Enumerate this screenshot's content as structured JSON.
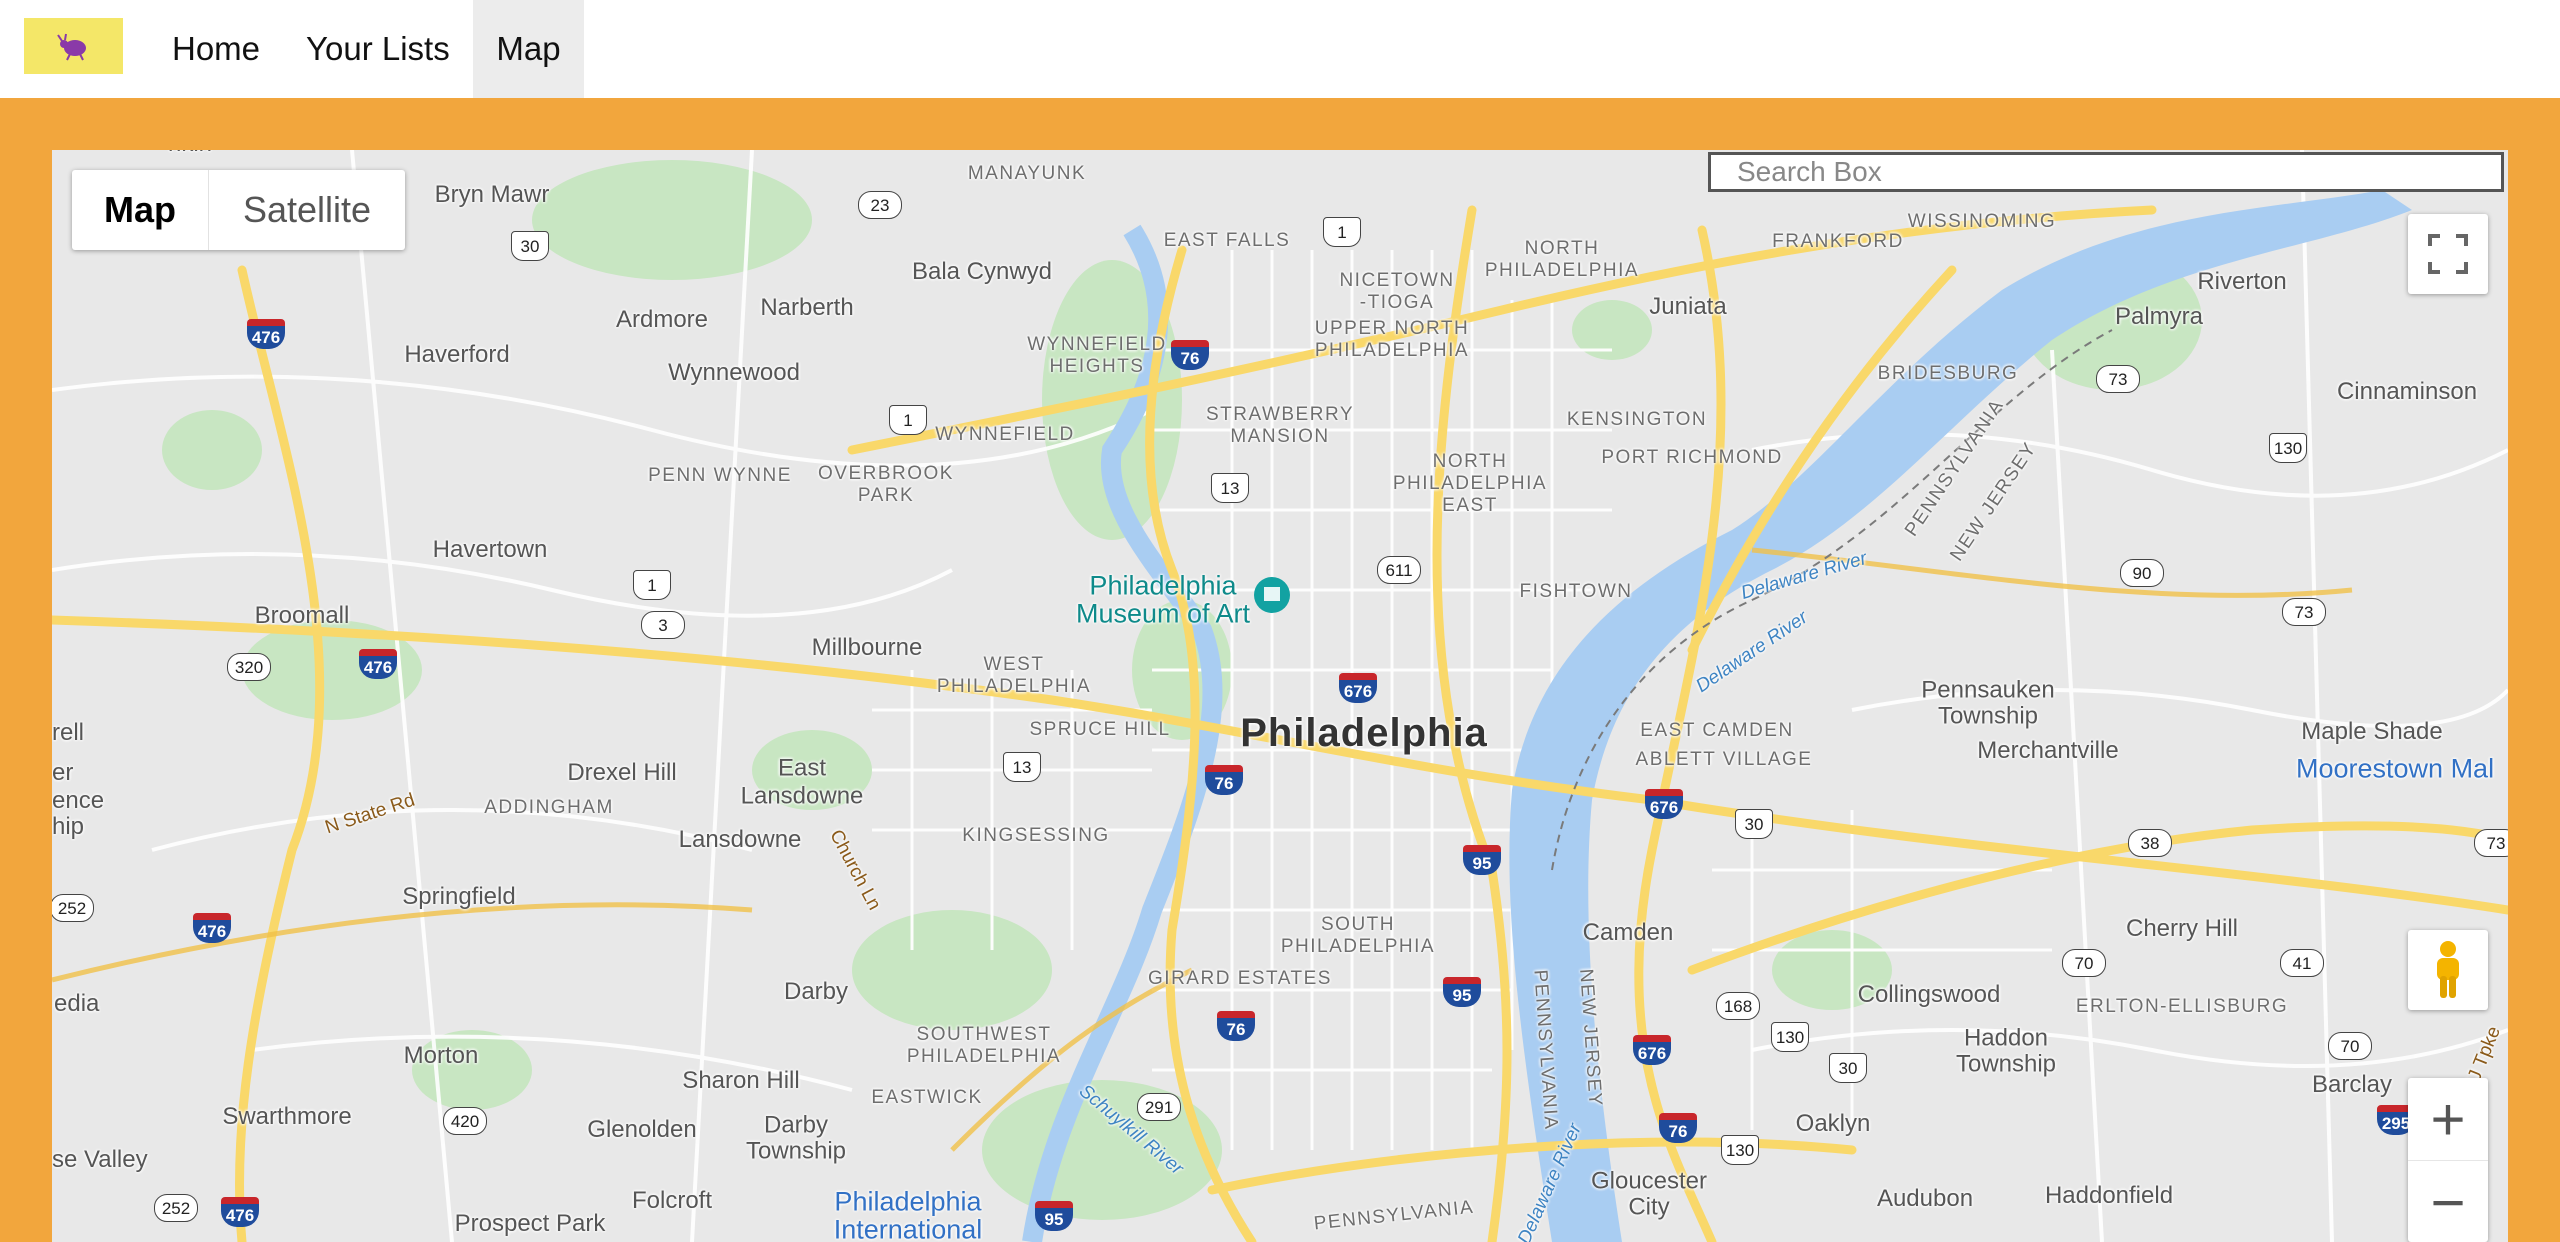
{
  "nav": {
    "home": "Home",
    "lists": "Your Lists",
    "map": "Map"
  },
  "map_controls": {
    "map_label": "Map",
    "satellite_label": "Satellite",
    "search_placeholder": "Search Box",
    "zoom_in": "+",
    "zoom_out": "−"
  },
  "colors": {
    "frame": "#f2a63d",
    "logo_bg": "#f4e768",
    "active_nav_bg": "#ececec"
  },
  "places": {
    "philadelphia": "Philadelphia",
    "bryn_mawr": "Bryn Mawr",
    "manayunk": "MANAYUNK",
    "bala_cynwyd": "Bala Cynwyd",
    "east_falls": "EAST FALLS",
    "nicetown": "NICETOWN\n-TIOGA",
    "north_philadelphia": "NORTH\nPHILADELPHIA",
    "frankford": "FRANKFORD",
    "wissinoming": "WISSINOMING",
    "riverton": "Riverton",
    "palmyra": "Palmyra",
    "cinnaminson": "Cinnaminson",
    "juniata": "Juniata",
    "bridesburg": "BRIDESBURG",
    "kensington": "KENSINGTON",
    "port_richmond": "PORT RICHMOND",
    "ardmore": "Ardmore",
    "narberth": "Narberth",
    "haverford": "Haverford",
    "wynnewood": "Wynnewood",
    "wynnefield_heights": "WYNNEFIELD\nHEIGHTS",
    "upper_north_phila": "UPPER NORTH\nPHILADELPHIA",
    "strawberry_mansion": "STRAWBERRY\nMANSION",
    "wynnefield": "WYNNEFIELD",
    "penn_wynne": "PENN WYNNE",
    "overbrook_park": "OVERBROOK\nPARK",
    "north_phila_east": "NORTH\nPHILADELPHIA\nEAST",
    "havertown": "Havertown",
    "broomall": "Broomall",
    "museum": "Philadelphia\nMuseum of Art",
    "fishtown": "FISHTOWN",
    "delaware_river": "Delaware River",
    "millbourne": "Millbourne",
    "west_philadelphia": "WEST\nPHILADELPHIA",
    "spruce_hill": "SPRUCE HILL",
    "east_camden": "EAST CAMDEN",
    "ablett_village": "ABLETT VILLAGE",
    "pennsauken": "Pennsauken\nTownship",
    "merchantville": "Merchantville",
    "maple_shade": "Maple Shade",
    "moorestown": "Moorestown Mal",
    "drexel_hill": "Drexel Hill",
    "east_lansdowne": "East\nLansdowne",
    "addingham": "ADDINGHAM",
    "lansdowne": "Lansdowne",
    "kingsessing": "KINGSESSING",
    "springfield": "Springfield",
    "camden": "Camden",
    "cherry_hill": "Cherry Hill",
    "south_philadelphia": "SOUTH\nPHILADELPHIA",
    "girard_estates": "GIRARD ESTATES",
    "darby": "Darby",
    "collingswood": "Collingswood",
    "erlton": "ERLTON-ELLISBURG",
    "southwest_phila": "SOUTHWEST\nPHILADELPHIA",
    "haddon_township": "Haddon\nTownship",
    "morton": "Morton",
    "sharon_hill": "Sharon Hill",
    "eastwick": "EASTWICK",
    "darby_township": "Darby\nTownship",
    "oaklyn": "Oaklyn",
    "barclay": "Barclay",
    "swarthmore": "Swarthmore",
    "glenolden": "Glenolden",
    "gloucester_city": "Gloucester\nCity",
    "audubon": "Audubon",
    "haddonfield": "Haddonfield",
    "folcroft": "Folcroft",
    "prospect_park": "Prospect Park",
    "phila_international": "Philadelphia\nInternational",
    "pennsylvania": "PENNSYLVANIA",
    "new_jersey": "NEW JERSEY",
    "schuylkill": "Schuylkill River",
    "n_state_rd": "N State Rd",
    "church_ln": "Church Ln",
    "nj_tpke": "NJ Tpke",
    "rell": "rell",
    "er": "er",
    "ence": "ence",
    "hip": "hip",
    "edia": "edia",
    "se_valley": "se Valley",
    "nkin": "nkin"
  },
  "shields": {
    "i476": "476",
    "i76": "76",
    "i676": "676",
    "i95": "95",
    "i295": "295",
    "us1": "1",
    "us30": "30",
    "us13": "13",
    "us130": "130",
    "us30b": "30",
    "pa23": "23",
    "pa3": "3",
    "pa320": "320",
    "pa252": "252",
    "pa420": "420",
    "pa291": "291",
    "pa611": "611",
    "nj73": "73",
    "nj90": "90",
    "nj38": "38",
    "nj70": "70",
    "nj41": "41",
    "nj168": "168"
  }
}
